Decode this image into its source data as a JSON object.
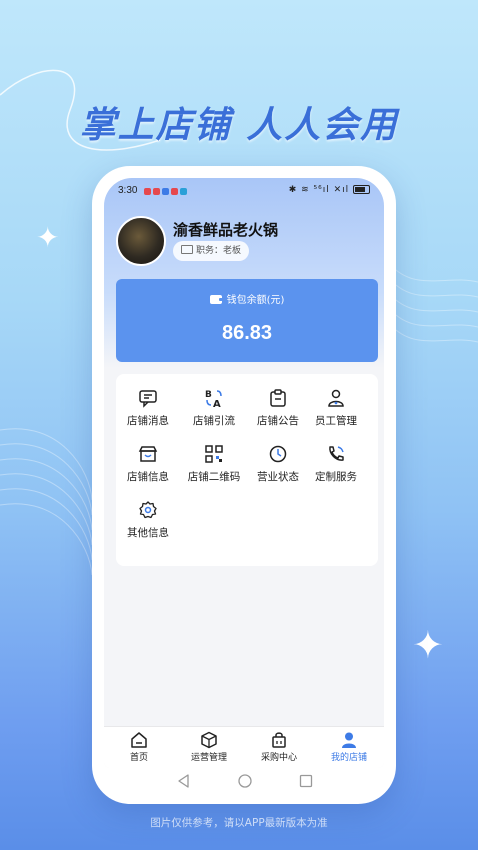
{
  "promo": {
    "slogan": "掌上店铺 人人会用",
    "disclaimer": "图片仅供参考，请以APP最新版本为准"
  },
  "status_bar": {
    "time": "3:30",
    "right_text": "✱ ≋ ⁵⁶ıl ✕ıl"
  },
  "profile": {
    "store_name": "渝香鲜品老火锅",
    "role_text": "职务：老板"
  },
  "wallet": {
    "label": "钱包余额(元)",
    "balance": "86.83"
  },
  "menu": {
    "items": [
      {
        "label": "店铺消息",
        "icon": "message-icon"
      },
      {
        "label": "店铺引流",
        "icon": "translate-icon"
      },
      {
        "label": "店铺公告",
        "icon": "notice-icon"
      },
      {
        "label": "员工管理",
        "icon": "staff-icon"
      },
      {
        "label": "店铺信息",
        "icon": "store-icon"
      },
      {
        "label": "店铺二维码",
        "icon": "qrcode-icon"
      },
      {
        "label": "营业状态",
        "icon": "clock-icon"
      },
      {
        "label": "定制服务",
        "icon": "phone-icon"
      },
      {
        "label": "其他信息",
        "icon": "gear-icon"
      }
    ]
  },
  "tabs": [
    {
      "label": "首页",
      "icon": "home-icon",
      "active": false
    },
    {
      "label": "运营管理",
      "icon": "box-icon",
      "active": false
    },
    {
      "label": "采购中心",
      "icon": "bag-icon",
      "active": false
    },
    {
      "label": "我的店铺",
      "icon": "user-icon",
      "active": true
    }
  ],
  "colors": {
    "accent": "#3d7be6",
    "wallet_bg": "#5b93ee",
    "slogan": "#3a6fd8"
  }
}
